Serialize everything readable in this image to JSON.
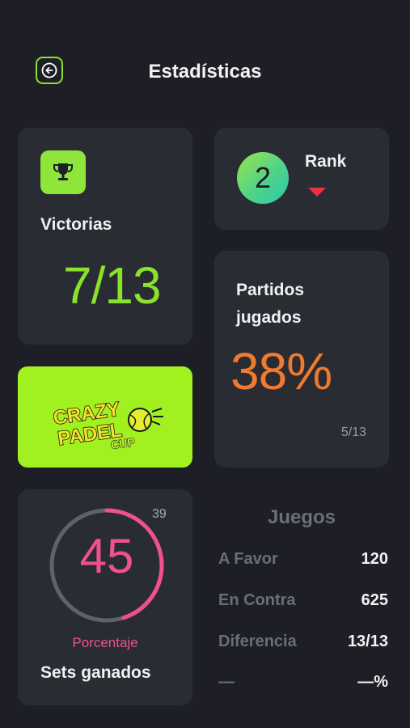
{
  "header": {
    "title": "Estadísticas",
    "back_icon": "arrow-left-icon"
  },
  "colors": {
    "accent_green": "#8be22b",
    "orange": "#f07a2e",
    "pink": "#ef4f93",
    "rank_down": "#e8323c",
    "background": "#1e1f26",
    "card": "#2a2c34"
  },
  "wins": {
    "icon": "trophy-icon",
    "label": "Victorias",
    "value": "7/13"
  },
  "rank": {
    "value": "2",
    "label": "Rank",
    "trend": "down"
  },
  "played": {
    "label": "Partidos jugados",
    "percent": "38%",
    "fraction": "5/13"
  },
  "logo": {
    "line1": "CRAZY",
    "line2": "PADEL",
    "line3": "CUP"
  },
  "sets": {
    "value": "45",
    "top_value": "39",
    "percent_label": "Porcentaje",
    "label": "Sets ganados",
    "ring_fill_fraction": 0.45
  },
  "games": {
    "title": "Juegos",
    "rows": [
      {
        "label": "A Favor",
        "value": "120"
      },
      {
        "label": "En Contra",
        "value": "625"
      },
      {
        "label": "Diferencia",
        "value": "13/13"
      },
      {
        "label": "—",
        "value": "—%"
      }
    ]
  }
}
